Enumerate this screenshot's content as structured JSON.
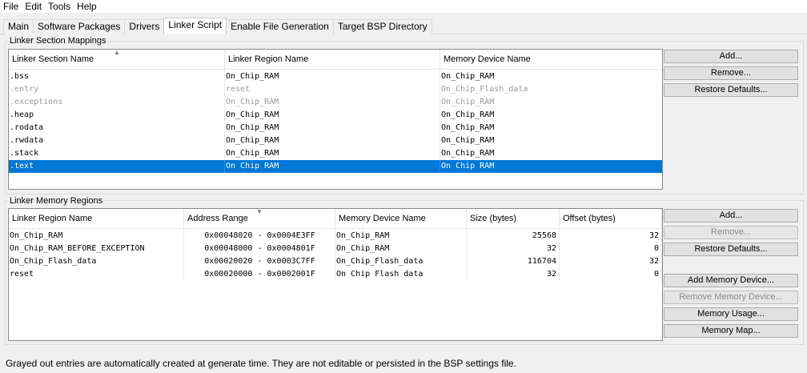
{
  "menu": [
    "File",
    "Edit",
    "Tools",
    "Help"
  ],
  "tabs": [
    "Main",
    "Software Packages",
    "Drivers",
    "Linker Script",
    "Enable File Generation",
    "Target BSP Directory"
  ],
  "active_tab": "Linker Script",
  "section_mappings": {
    "group_title": "Linker Section Mappings",
    "columns": [
      "Linker Section Name",
      "Linker Region Name",
      "Memory Device Name"
    ],
    "rows": [
      {
        "section": ".bss",
        "region": "On_Chip_RAM",
        "device": "On_Chip_RAM",
        "state": "normal"
      },
      {
        "section": ".entry",
        "region": "reset",
        "device": "On_Chip_Flash_data",
        "state": "gray"
      },
      {
        "section": ".exceptions",
        "region": "On_Chip_RAM",
        "device": "On_Chip_RAM",
        "state": "gray"
      },
      {
        "section": ".heap",
        "region": "On_Chip_RAM",
        "device": "On_Chip_RAM",
        "state": "normal"
      },
      {
        "section": ".rodata",
        "region": "On_Chip_RAM",
        "device": "On_Chip_RAM",
        "state": "normal"
      },
      {
        "section": ".rwdata",
        "region": "On_Chip_RAM",
        "device": "On_Chip_RAM",
        "state": "normal"
      },
      {
        "section": ".stack",
        "region": "On_Chip_RAM",
        "device": "On_Chip_RAM",
        "state": "normal"
      },
      {
        "section": ".text",
        "region": "On Chip RAM",
        "device": "On Chip RAM",
        "state": "selected"
      }
    ],
    "buttons": {
      "add": "Add...",
      "remove": "Remove...",
      "restore": "Restore Defaults..."
    }
  },
  "memory_regions": {
    "group_title": "Linker Memory Regions",
    "columns": [
      "Linker Region Name",
      "Address Range",
      "Memory Device Name",
      "Size (bytes)",
      "Offset (bytes)"
    ],
    "rows": [
      {
        "region": "On_Chip_RAM",
        "range": "0x00048020 - 0x0004E3FF",
        "device": "On_Chip_RAM",
        "size": "25568",
        "offset": "32"
      },
      {
        "region": "On_Chip_RAM_BEFORE_EXCEPTION",
        "range": "0x00048000 - 0x0004801F",
        "device": "On_Chip_RAM",
        "size": "32",
        "offset": "0"
      },
      {
        "region": "On_Chip_Flash_data",
        "range": "0x00020020 - 0x0003C7FF",
        "device": "On_Chip_Flash_data",
        "size": "116704",
        "offset": "32"
      },
      {
        "region": "reset",
        "range": "0x00020000 - 0x0002001F",
        "device": "On Chip Flash data",
        "size": "32",
        "offset": "0"
      }
    ],
    "buttons": {
      "add": "Add...",
      "remove": "Remove...",
      "restore": "Restore Defaults...",
      "add_device": "Add Memory Device...",
      "remove_device": "Remove Memory Device...",
      "usage": "Memory Usage...",
      "map": "Memory Map..."
    }
  },
  "footer_text": "Grayed out entries are automatically created at generate time. They are not editable or persisted in the BSP settings file.",
  "colors": {
    "selection": "#0078d7",
    "grayed_text": "#9a9a9a"
  }
}
